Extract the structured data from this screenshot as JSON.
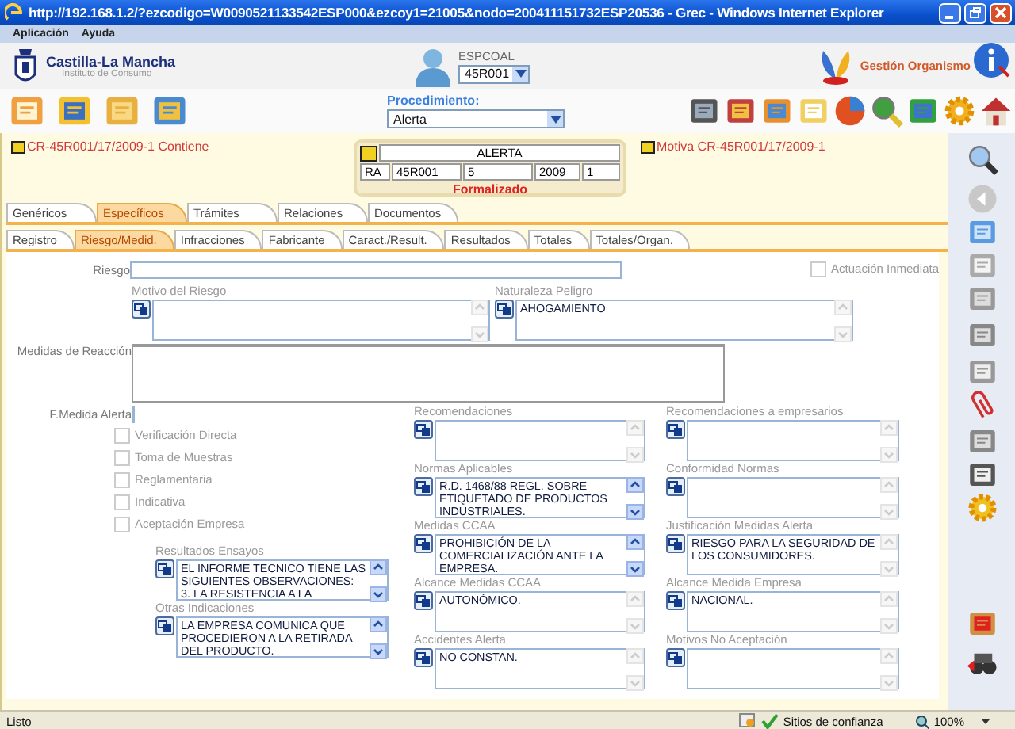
{
  "window": {
    "title": "http://192.168.1.2/?ezcodigo=W0090521133542ESP000&ezcoy1=21005&nodo=200411151732ESP20536 - Grec - Windows Internet Explorer"
  },
  "menu": [
    "Aplicación",
    "Ayuda"
  ],
  "header": {
    "org_name": "Castilla-La Mancha",
    "org_subtitle": "Instituto de Consumo",
    "user_label": "ESPCOAL",
    "user_select": "45R001",
    "module": "Gestión Organismo"
  },
  "toolbar": {
    "procedure_label": "Procedimiento:",
    "procedure_value": "Alerta"
  },
  "links": {
    "left": "CR-45R001/17/2009-1 Contiene",
    "right": "Motiva CR-45R001/17/2009-1"
  },
  "record": {
    "title": "ALERTA",
    "cells": [
      "RA",
      "45R001",
      "5",
      "2009",
      "1"
    ],
    "status": "Formalizado"
  },
  "tabs": [
    {
      "label": "Genéricos",
      "selected": false
    },
    {
      "label": "Específicos",
      "selected": true
    },
    {
      "label": "Trámites",
      "selected": false
    },
    {
      "label": "Relaciones",
      "selected": false
    },
    {
      "label": "Documentos",
      "selected": false
    }
  ],
  "subtabs": [
    {
      "label": "Registro",
      "selected": false
    },
    {
      "label": "Riesgo/Medid.",
      "selected": true
    },
    {
      "label": "Infracciones",
      "selected": false
    },
    {
      "label": "Fabricante",
      "selected": false
    },
    {
      "label": "Caract./Result.",
      "selected": false
    },
    {
      "label": "Resultados",
      "selected": false
    },
    {
      "label": "Totales",
      "selected": false
    },
    {
      "label": "Totales/Organ.",
      "selected": false
    }
  ],
  "form": {
    "riesgo_label": "Riesgo",
    "actuacion": {
      "label": "Actuación Inmediata",
      "checked": false,
      "disabled": true
    },
    "top_fields": [
      {
        "label": "Motivo del Riesgo",
        "scrollable": false
      },
      {
        "label": "Naturaleza Peligro",
        "lines": [
          "AHOGAMIENTO"
        ],
        "scrollable": false
      }
    ],
    "medidas_label": "Medidas de Reacción",
    "fecha_label": "F.Medida Alerta",
    "checkboxes": [
      {
        "label": "Verificación Directa",
        "checked": false,
        "disabled": true
      },
      {
        "label": "Toma de Muestras",
        "checked": false,
        "disabled": true
      },
      {
        "label": "Reglamentaria",
        "checked": false,
        "disabled": true
      },
      {
        "label": "Indicativa",
        "checked": false,
        "disabled": true
      },
      {
        "label": "Aceptación Empresa",
        "checked": false,
        "disabled": true
      }
    ],
    "left_fields": [
      {
        "label": "Resultados Ensayos",
        "lines": [
          "EL INFORME TECNICO TIENE LAS",
          "SIGUIENTES OBSERVACIONES:",
          "3. LA RESISTENCIA A LA"
        ],
        "scrollable": true
      },
      {
        "label": "Otras Indicaciones",
        "lines": [
          "LA EMPRESA COMUNICA QUE",
          "PROCEDIERON A LA RETIRADA",
          "DEL PRODUCTO."
        ],
        "scrollable": true
      }
    ],
    "center_fields": [
      {
        "label": "Recomendaciones",
        "scrollable": false
      },
      {
        "label": "Normas Aplicables",
        "lines": [
          "R.D. 1468/88 REGL. SOBRE",
          "ETIQUETADO DE PRODUCTOS",
          "INDUSTRIALES."
        ],
        "scrollable": true
      },
      {
        "label": "Medidas CCAA",
        "lines": [
          "PROHIBICIÓN DE LA",
          "COMERCIALIZACIÓN ANTE LA",
          "EMPRESA."
        ],
        "scrollable": true
      },
      {
        "label": "Alcance Medidas CCAA",
        "lines": [
          "AUTONÓMICO."
        ],
        "scrollable": false
      },
      {
        "label": "Accidentes Alerta",
        "lines": [
          "NO CONSTAN."
        ],
        "scrollable": false
      }
    ],
    "right_fields": [
      {
        "label": "Recomendaciones a empresarios",
        "scrollable": false
      },
      {
        "label": "Conformidad Normas",
        "scrollable": false
      },
      {
        "label": "Justificación Medidas Alerta",
        "lines": [
          "RIESGO PARA LA SEGURIDAD DE",
          "LOS CONSUMIDORES."
        ],
        "scrollable": false
      },
      {
        "label": "Alcance Medida Empresa",
        "lines": [
          "NACIONAL."
        ],
        "scrollable": false
      },
      {
        "label": "Motivos No Aceptación",
        "scrollable": false
      }
    ]
  },
  "status_bar": {
    "text": "Listo",
    "zone": "Sitios de confianza",
    "zoom": "100%"
  }
}
